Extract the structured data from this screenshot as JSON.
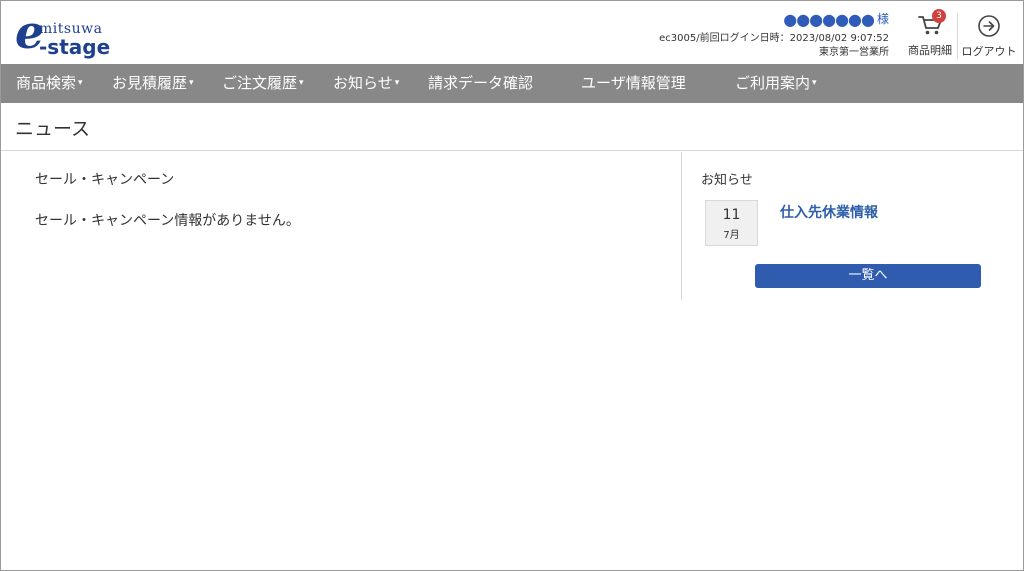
{
  "logo": {
    "brand_top": "mitsuwa",
    "brand_e": "e",
    "brand_bottom": "-stage"
  },
  "user": {
    "name_masked": "●●●●●●●",
    "honorific": "様",
    "meta": "ec3005/前回ログイン日時：2023/08/02 9:07:52",
    "office": "東京第一営業所"
  },
  "header": {
    "cart_label": "商品明細",
    "cart_count": "3",
    "logout_label": "ログアウト",
    "cart_icon": "cart-icon",
    "logout_icon": "logout-arrow-icon"
  },
  "nav": {
    "items": [
      {
        "label": "商品検索",
        "dropdown": true
      },
      {
        "label": "お見積履歴",
        "dropdown": true
      },
      {
        "label": "ご注文履歴",
        "dropdown": true
      },
      {
        "label": "お知らせ",
        "dropdown": true
      },
      {
        "label": "請求データ確認",
        "dropdown": false
      },
      {
        "label": "ユーザ情報管理",
        "dropdown": false
      },
      {
        "label": "ご利用案内",
        "dropdown": true
      }
    ]
  },
  "page": {
    "title": "ニュース"
  },
  "sale": {
    "heading": "セール・キャンペーン",
    "empty_message": "セール・キャンペーン情報がありません。"
  },
  "notices": {
    "heading": "お知らせ",
    "items": [
      {
        "day": "11",
        "month": "7月",
        "title": "仕入先休業情報"
      }
    ],
    "list_button": "一覧へ"
  },
  "colors": {
    "nav_bg": "#888888",
    "brand": "#1f3f8f",
    "link": "#2e5fa8",
    "button": "#2f5cae",
    "badge": "#d0413f"
  }
}
